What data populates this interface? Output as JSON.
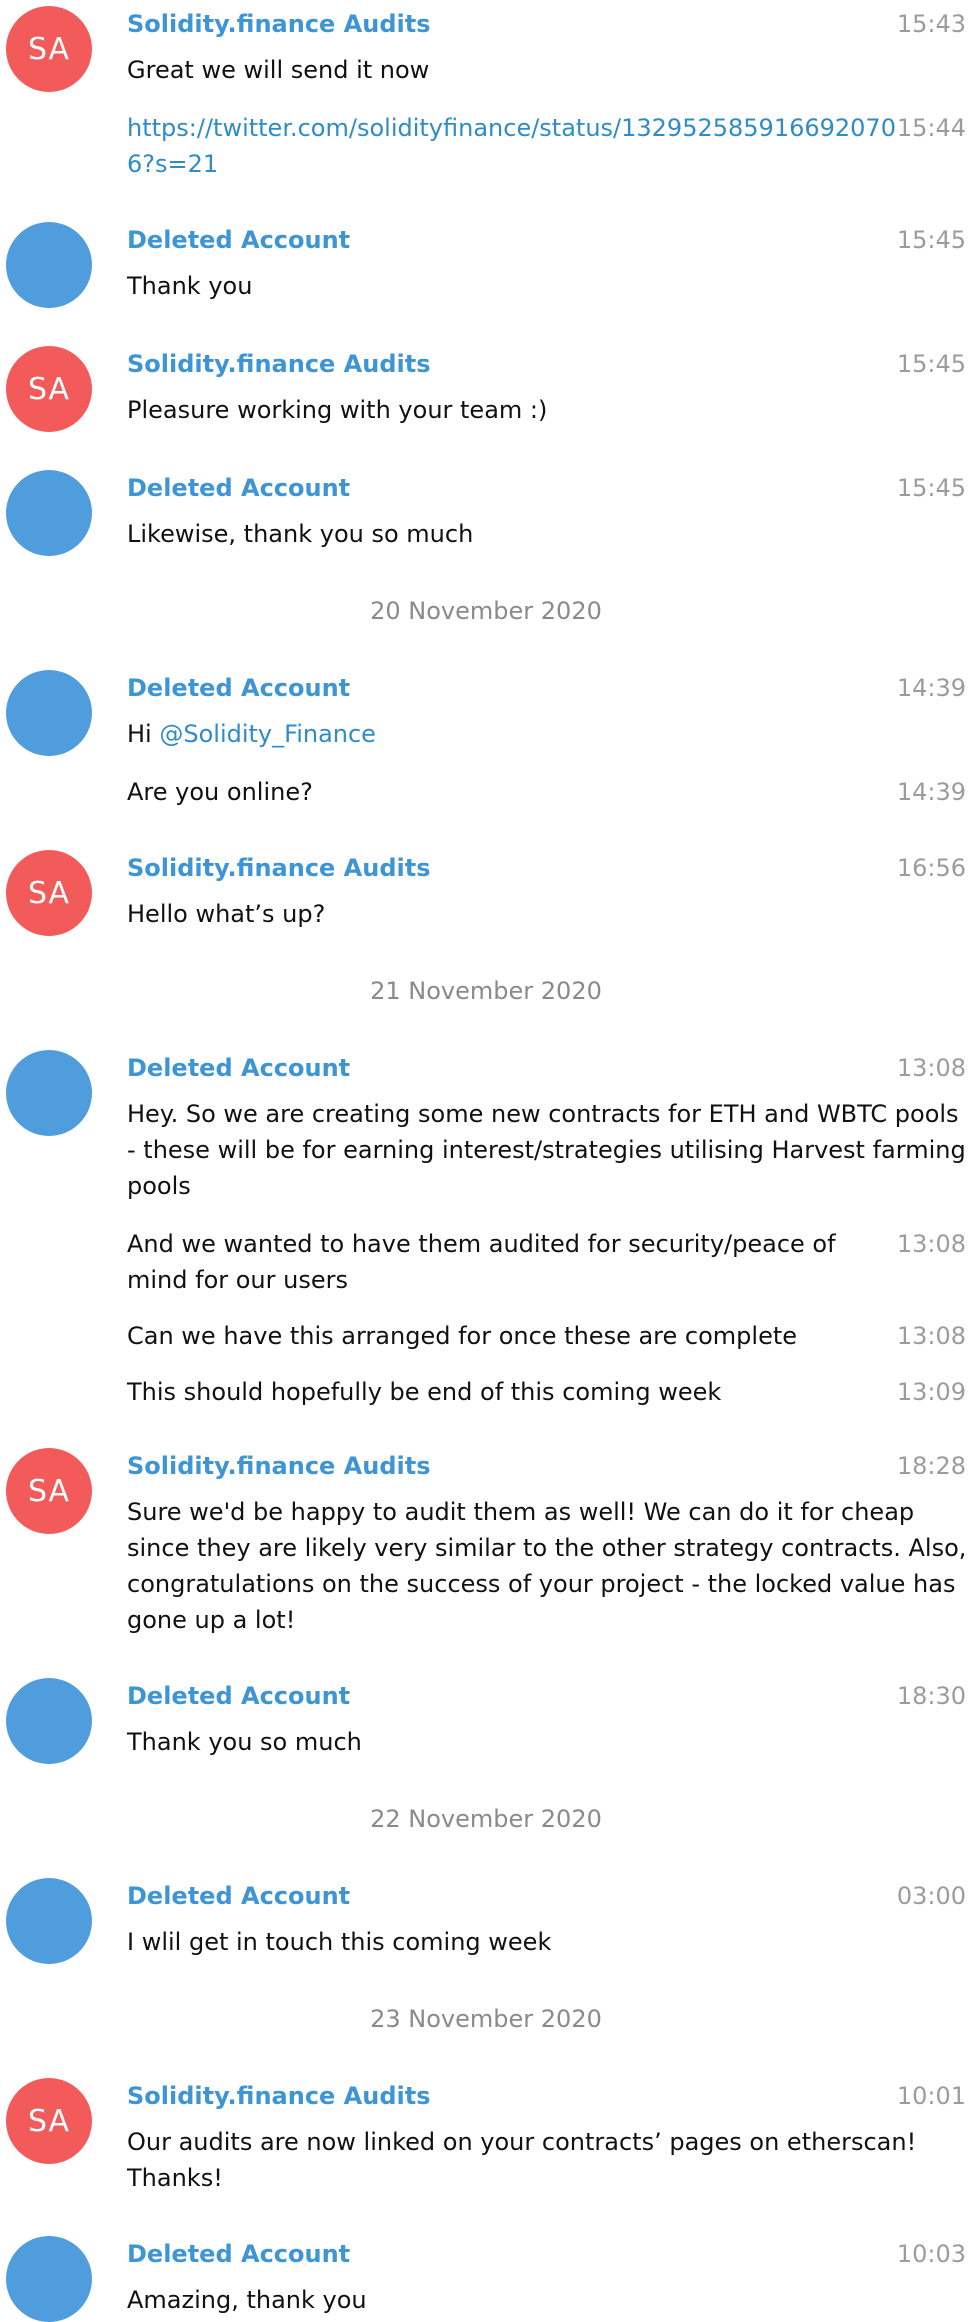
{
  "colors": {
    "avatar_red": "#f35a5a",
    "avatar_blue": "#4f9ddd",
    "name_blue": "#3e95d6",
    "link_blue": "#2f8cc6"
  },
  "names": {
    "sa": "Solidity.finance Audits",
    "da": "Deleted Account"
  },
  "avatar_initials": "SA",
  "dates": [
    "20 November 2020",
    "21 November 2020",
    "22 November 2020",
    "23 November 2020"
  ],
  "g1": {
    "time1": "15:43",
    "text1": "Great we will send it now",
    "time2": "15:44",
    "link": "https://twitter.com/solidityfinance/status/1329525859166920706?s=21"
  },
  "g2": {
    "time": "15:45",
    "text": "Thank you"
  },
  "g3": {
    "time": "15:45",
    "text": "Pleasure working with your team :)"
  },
  "g4": {
    "time": "15:45",
    "text": "Likewise, thank you so much"
  },
  "g5": {
    "time1": "14:39",
    "greeting": "Hi",
    "mention": "@Solidity_Finance",
    "time2": "14:39",
    "text2": "Are you online?"
  },
  "g6": {
    "time": "16:56",
    "text": "Hello what’s up?"
  },
  "g7": {
    "time1": "13:08",
    "text1": "Hey. So we are creating some new contracts for ETH and WBTC pools - these will be for earning interest/strategies utilising Harvest farming pools",
    "time2": "13:08",
    "text2": "And we wanted to have them audited for security/peace of mind for our users",
    "time3": "13:08",
    "text3": "Can we have this arranged for once these are complete",
    "time4": "13:09",
    "text4": "This should hopefully be end of this coming week"
  },
  "g8": {
    "time": "18:28",
    "text": "Sure we'd be happy to audit them as well! We can do it for cheap since they are likely very similar to the other strategy contracts. Also, congratulations on the success of your project - the locked value has gone up a lot!"
  },
  "g9": {
    "time": "18:30",
    "text": "Thank you so much"
  },
  "g10": {
    "time": "03:00",
    "text": "I wlil get in touch this coming week"
  },
  "g11": {
    "time": "10:01",
    "text": "Our audits are now linked on your contracts’ pages on etherscan! Thanks!"
  },
  "g12": {
    "time": "10:03",
    "text": "Amazing, thank you"
  }
}
